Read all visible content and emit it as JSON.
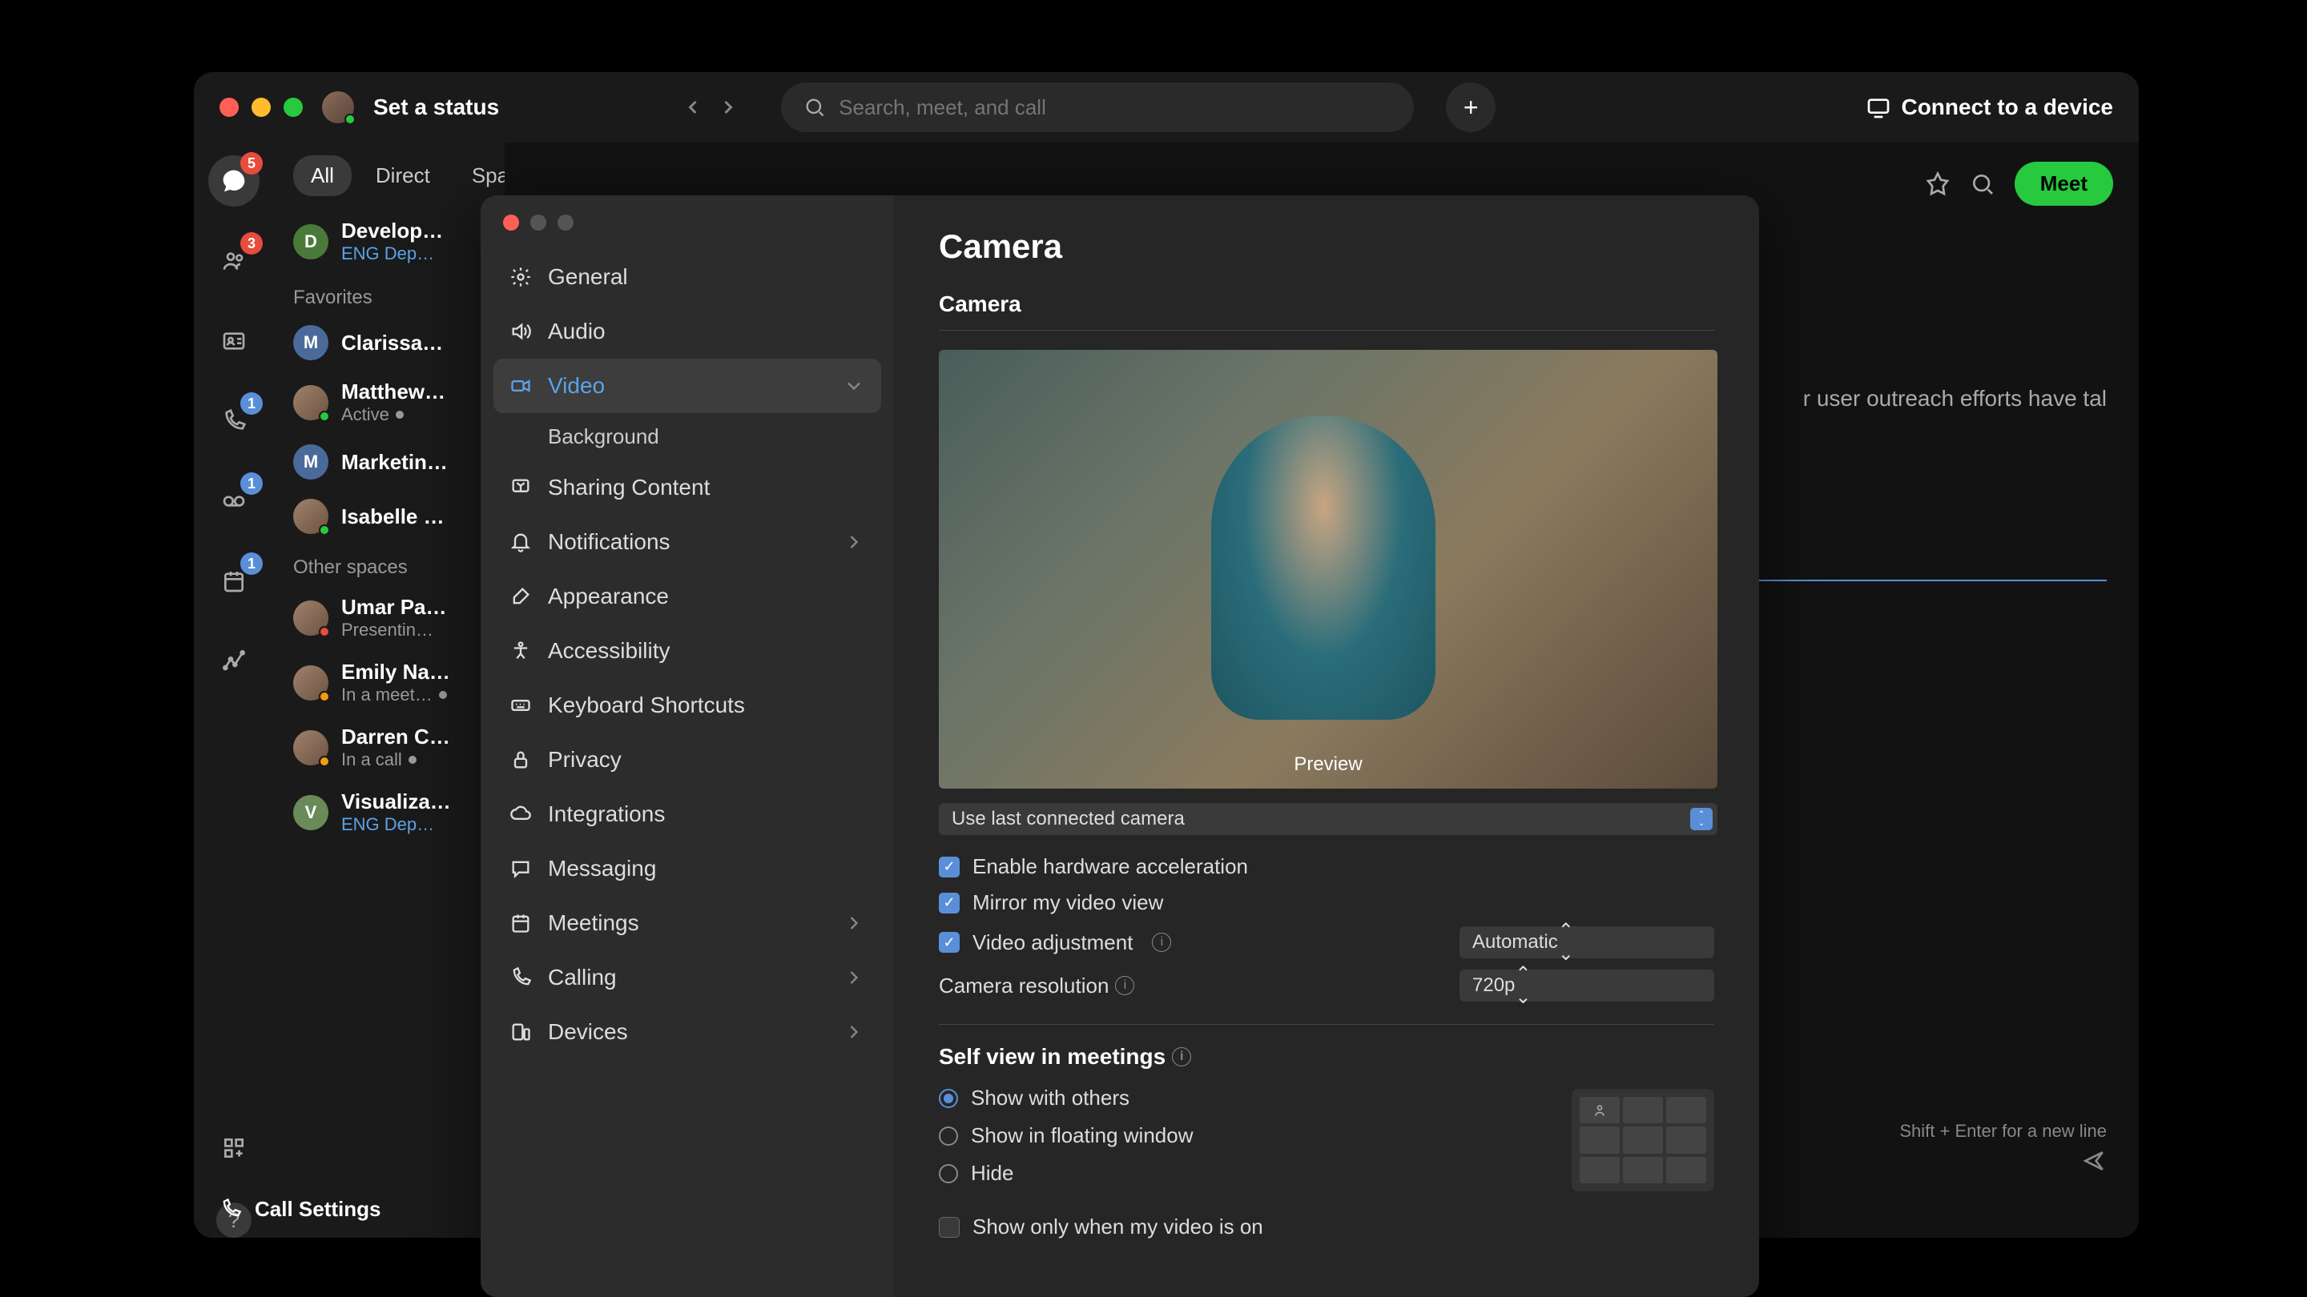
{
  "titlebar": {
    "status": "Set a status",
    "search_placeholder": "Search, meet, and call",
    "connect": "Connect to a device"
  },
  "rail": {
    "badges": {
      "messaging": "5",
      "teams": "3",
      "calls": "1",
      "voicemail": "1",
      "meetings": "1"
    }
  },
  "sidebar": {
    "tabs": [
      "All",
      "Direct",
      "Spaces"
    ],
    "active_tab": 0,
    "dev_space": {
      "name": "Develop…",
      "sub": "ENG Dep…",
      "initial": "D",
      "color": "#4a7a3a"
    },
    "favorites_label": "Favorites",
    "favorites": [
      {
        "name": "Clarissa…",
        "initial": "M",
        "color": "#4a6a9a",
        "sub": ""
      },
      {
        "name": "Matthew…",
        "sub": "Active",
        "img": true
      },
      {
        "name": "Marketin…",
        "initial": "M",
        "color": "#4a6a9a",
        "sub": ""
      },
      {
        "name": "Isabelle …",
        "img": true,
        "sub": ""
      }
    ],
    "other_label": "Other spaces",
    "other": [
      {
        "name": "Umar Pa…",
        "sub": "Presentin…",
        "img": true,
        "badge": "dnd"
      },
      {
        "name": "Emily Na…",
        "sub": "In a meet…",
        "img": true,
        "badge": "meeting"
      },
      {
        "name": "Darren C…",
        "sub": "In a call",
        "img": true,
        "badge": "call"
      },
      {
        "name": "Visualiza…",
        "sub": "ENG Dep…",
        "initial": "V",
        "color": "#6a8a5a",
        "link": true
      }
    ],
    "call_settings": "Call Settings"
  },
  "content": {
    "meet": "Meet",
    "bg_text": "r user outreach efforts have tal",
    "compose_hint": "Shift + Enter for a new line"
  },
  "settings": {
    "nav": [
      {
        "label": "General",
        "icon": "gear"
      },
      {
        "label": "Audio",
        "icon": "speaker"
      },
      {
        "label": "Video",
        "icon": "video",
        "active": true,
        "expanded": true,
        "sub": [
          "Background"
        ]
      },
      {
        "label": "Sharing Content",
        "icon": "share"
      },
      {
        "label": "Notifications",
        "icon": "bell",
        "expandable": true
      },
      {
        "label": "Appearance",
        "icon": "brush"
      },
      {
        "label": "Accessibility",
        "icon": "accessibility"
      },
      {
        "label": "Keyboard Shortcuts",
        "icon": "keyboard"
      },
      {
        "label": "Privacy",
        "icon": "lock"
      },
      {
        "label": "Integrations",
        "icon": "cloud"
      },
      {
        "label": "Messaging",
        "icon": "message"
      },
      {
        "label": "Meetings",
        "icon": "calendar",
        "expandable": true
      },
      {
        "label": "Calling",
        "icon": "phone",
        "expandable": true
      },
      {
        "label": "Devices",
        "icon": "device",
        "expandable": true
      }
    ],
    "title": "Camera",
    "camera_section": "Camera",
    "preview_label": "Preview",
    "camera_dd": "Use last connected camera",
    "checks": {
      "hw_accel": "Enable hardware acceleration",
      "mirror": "Mirror my video view",
      "adjust": "Video adjustment"
    },
    "adjust_dd": "Automatic",
    "resolution_label": "Camera resolution",
    "resolution_dd": "720p",
    "selfview_section": "Self view in meetings",
    "selfview_opts": [
      "Show with others",
      "Show in floating window",
      "Hide"
    ],
    "selfview_selected": 0,
    "show_only_label": "Show only when my video is on"
  }
}
